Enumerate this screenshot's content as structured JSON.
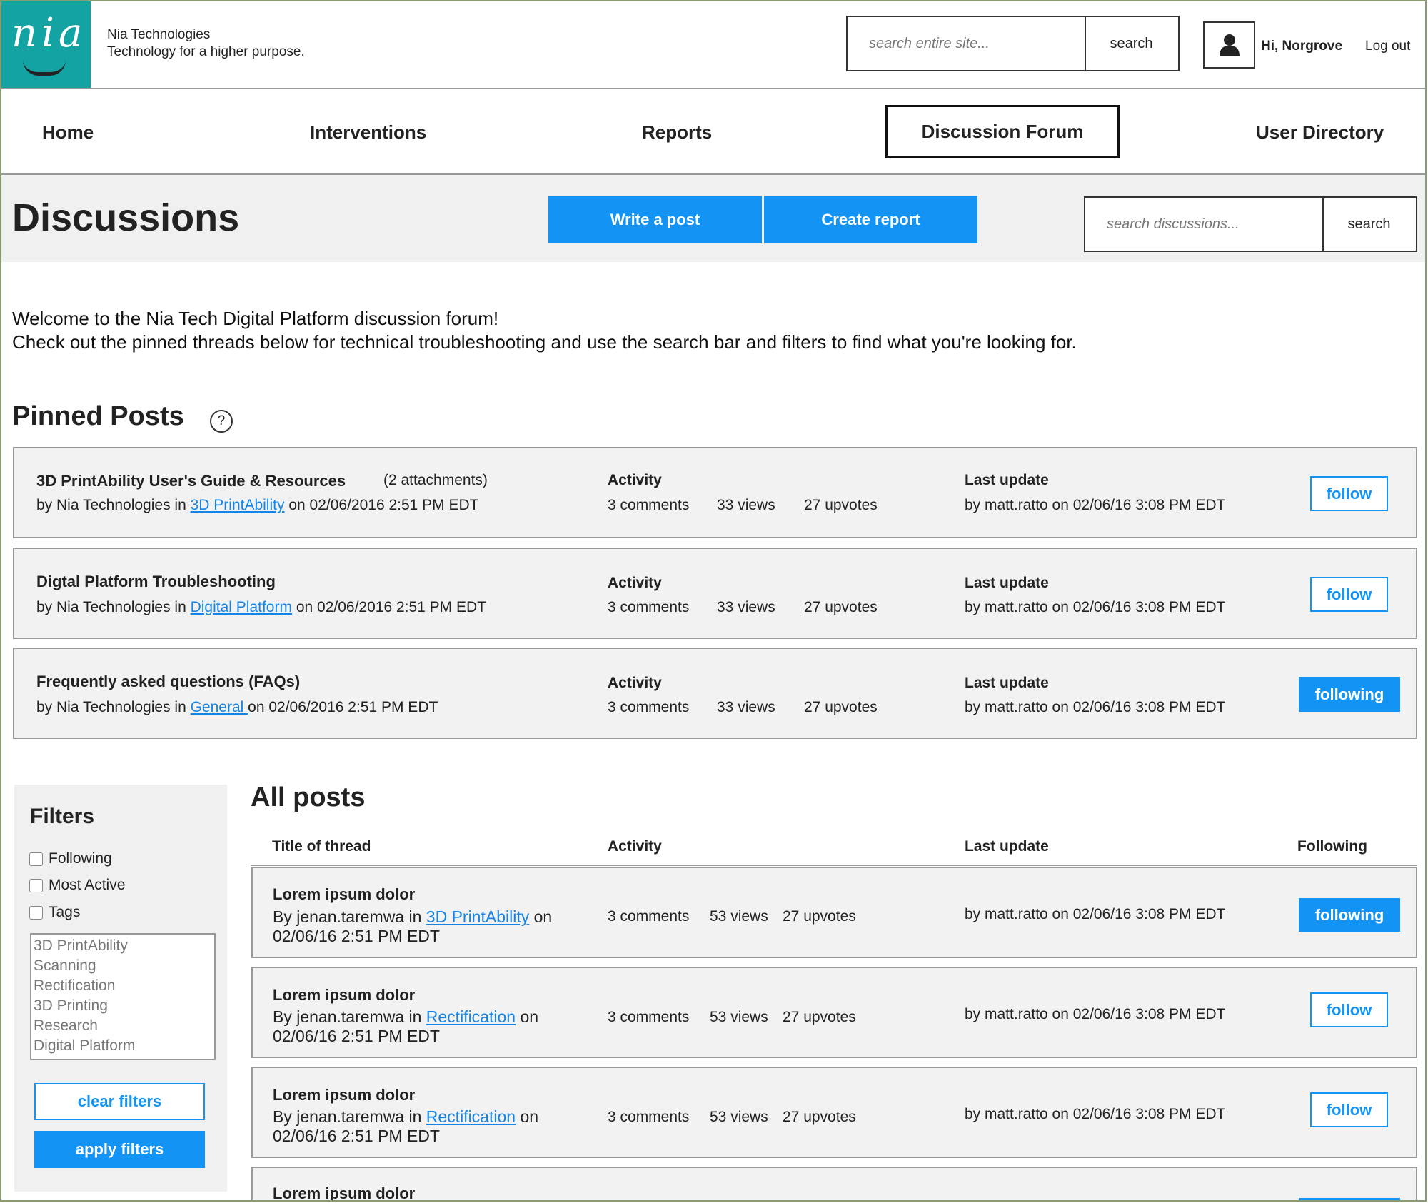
{
  "header": {
    "logo_text": "nia",
    "company_name": "Nia Technologies",
    "tagline": "Technology for a higher purpose.",
    "site_search_placeholder": "search entire site...",
    "site_search_button": "search",
    "greeting": "Hi, Norgrove",
    "logout": "Log out"
  },
  "nav": {
    "home": "Home",
    "interventions": "Interventions",
    "reports": "Reports",
    "forum": "Discussion Forum",
    "directory": "User Directory"
  },
  "toolbar": {
    "title": "Discussions",
    "write_post": "Write a post",
    "create_report": "Create report",
    "search_placeholder": "search discussions...",
    "search_button": "search"
  },
  "welcome": {
    "line1": "Welcome to the Nia Tech Digital Platform discussion forum!",
    "line2": "Check out the pinned threads below for technical troubleshooting and use the search bar and filters to find what you're looking for."
  },
  "pinned": {
    "heading": "Pinned Posts",
    "help": "?",
    "activity_label": "Activity",
    "last_update_label": "Last update",
    "posts": [
      {
        "title": "3D PrintAbility User's Guide & Resources",
        "attachments": "(2 attachments)",
        "by": "by Nia Technologies in",
        "category": "3D PrintAbility",
        "date": "on 02/06/2016 2:51 PM EDT",
        "comments": "3 comments",
        "views": "33 views",
        "upvotes": "27 upvotes",
        "update": "by matt.ratto on 02/06/16 3:08 PM EDT",
        "button": "follow"
      },
      {
        "title": "Digtal Platform Troubleshooting",
        "attachments": "",
        "by": "by Nia Technologies in",
        "category": "Digital Platform",
        "date": "on 02/06/2016 2:51 PM EDT",
        "comments": "3 comments",
        "views": "33 views",
        "upvotes": "27 upvotes",
        "update": "by matt.ratto on 02/06/16 3:08 PM EDT",
        "button": "follow"
      },
      {
        "title": "Frequently asked questions (FAQs)",
        "attachments": "",
        "by": "by Nia Technologies in",
        "category": "General ",
        "date": "on 02/06/2016 2:51 PM EDT",
        "comments": "3 comments",
        "views": "33 views",
        "upvotes": "27 upvotes",
        "update": "by matt.ratto on 02/06/16 3:08 PM EDT",
        "button": "following"
      }
    ]
  },
  "filters": {
    "heading": "Filters",
    "options": [
      "Following",
      "Most Active",
      "Tags"
    ],
    "tags": [
      "3D PrintAbility",
      "Scanning",
      "Rectification",
      "3D Printing",
      "Research",
      "Digital Platform"
    ],
    "clear": "clear filters",
    "apply": "apply filters"
  },
  "all_posts": {
    "heading": "All posts",
    "columns": [
      "Title of thread",
      "Activity",
      "Last update",
      "Following"
    ],
    "posts": [
      {
        "title": "Lorem ipsum dolor",
        "by": "By jenan.taremwa in",
        "category": "3D PrintAbility",
        "on": "on",
        "date": "02/06/16 2:51 PM EDT",
        "comments": "3 comments",
        "views": "53 views",
        "upvotes": "27 upvotes",
        "update": "by matt.ratto on 02/06/16 3:08 PM EDT",
        "button": "following"
      },
      {
        "title": "Lorem ipsum dolor",
        "by": "By jenan.taremwa in",
        "category": "Rectification",
        "on": "on",
        "date": "02/06/16 2:51 PM EDT",
        "comments": "3 comments",
        "views": "53 views",
        "upvotes": "27 upvotes",
        "update": "by matt.ratto on 02/06/16 3:08 PM EDT",
        "button": "follow"
      },
      {
        "title": "Lorem ipsum dolor",
        "by": "By jenan.taremwa in",
        "category": "Rectification",
        "on": "on",
        "date": "02/06/16 2:51 PM EDT",
        "comments": "3 comments",
        "views": "53 views",
        "upvotes": "27 upvotes",
        "update": "by matt.ratto on 02/06/16 3:08 PM EDT",
        "button": "follow"
      },
      {
        "title": "Lorem ipsum dolor"
      }
    ]
  },
  "colors": {
    "accent": "#1394f5",
    "brand": "#14a3a3",
    "panel": "#f2f2f2"
  }
}
